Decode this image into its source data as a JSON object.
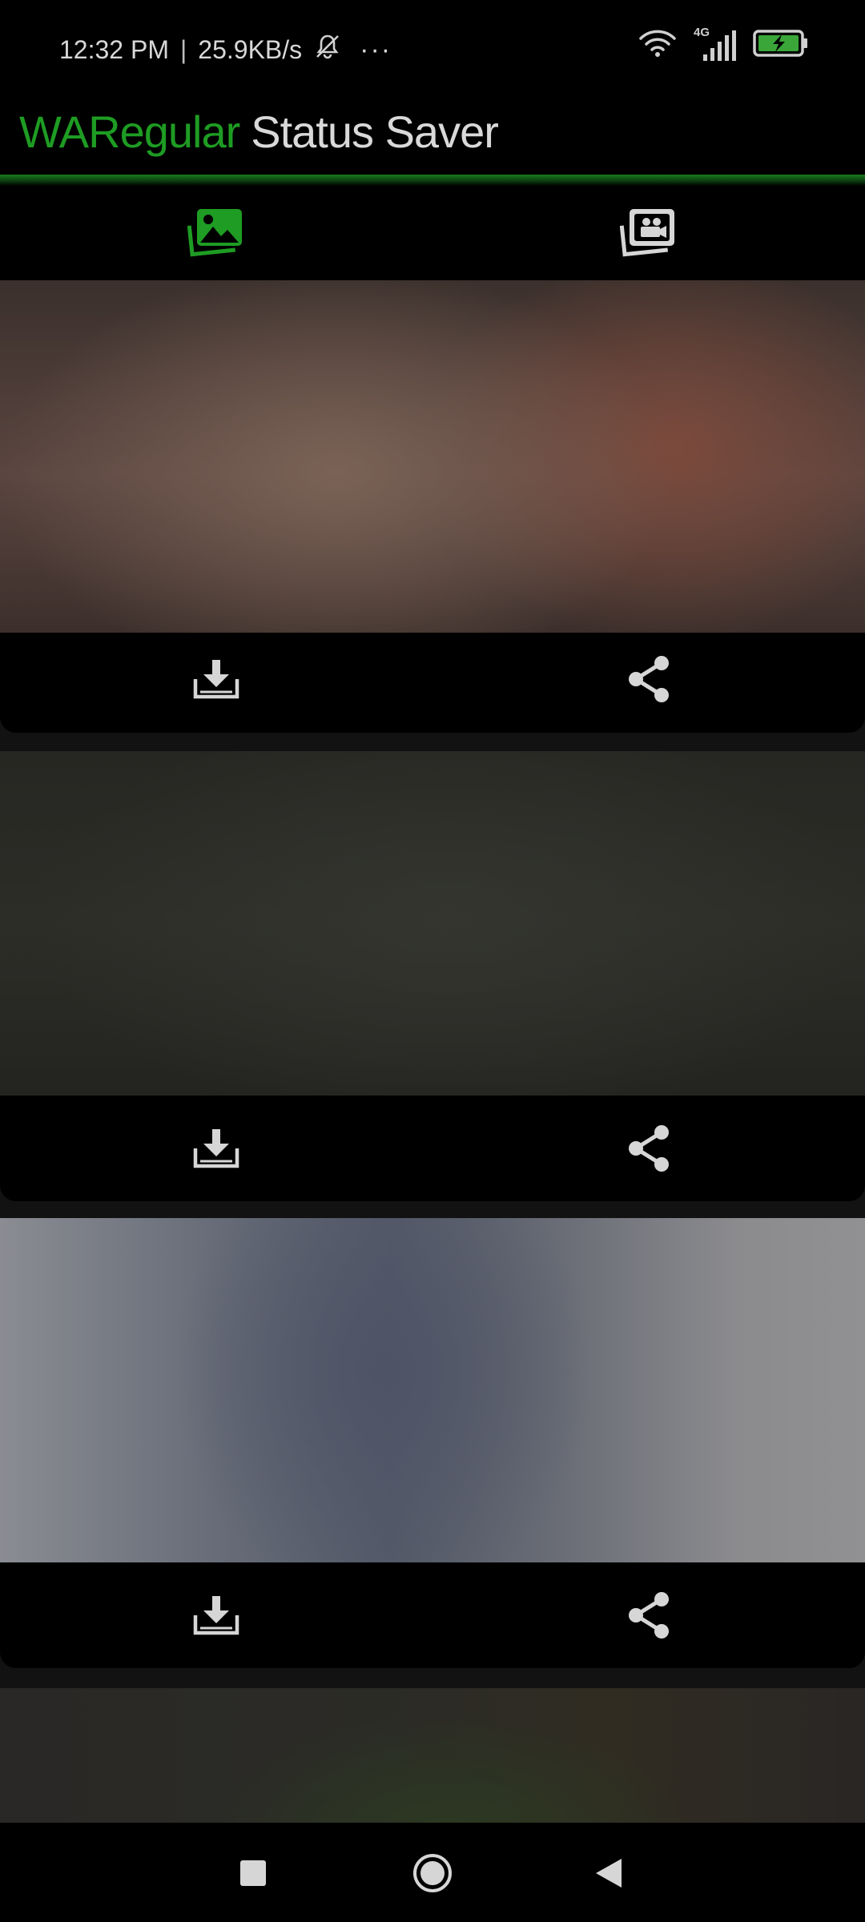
{
  "status_bar": {
    "time": "12:32 PM",
    "separator": "|",
    "speed": "25.9KB/s",
    "more": "···",
    "network_type": "4G",
    "icons": [
      "bell-off-icon",
      "wifi-icon",
      "signal-icon",
      "battery-charging-icon"
    ]
  },
  "app_bar": {
    "title_brand": "WARegular",
    "title_rest": "Status Saver"
  },
  "tabs": [
    {
      "icon": "photo-icon",
      "active": true
    },
    {
      "icon": "video-icon",
      "active": false
    }
  ],
  "cards": [
    {
      "icons": [
        "download-icon",
        "share-icon"
      ]
    },
    {
      "icons": [
        "download-icon",
        "share-icon"
      ]
    },
    {
      "icons": [
        "download-icon",
        "share-icon"
      ]
    },
    {
      "icons": []
    }
  ],
  "colors": {
    "accent": "#1e9c23",
    "background": "#000000",
    "icon": "#d6d6d6"
  },
  "nav_bar": {
    "icons": [
      "recents-icon",
      "home-icon",
      "back-icon"
    ]
  }
}
